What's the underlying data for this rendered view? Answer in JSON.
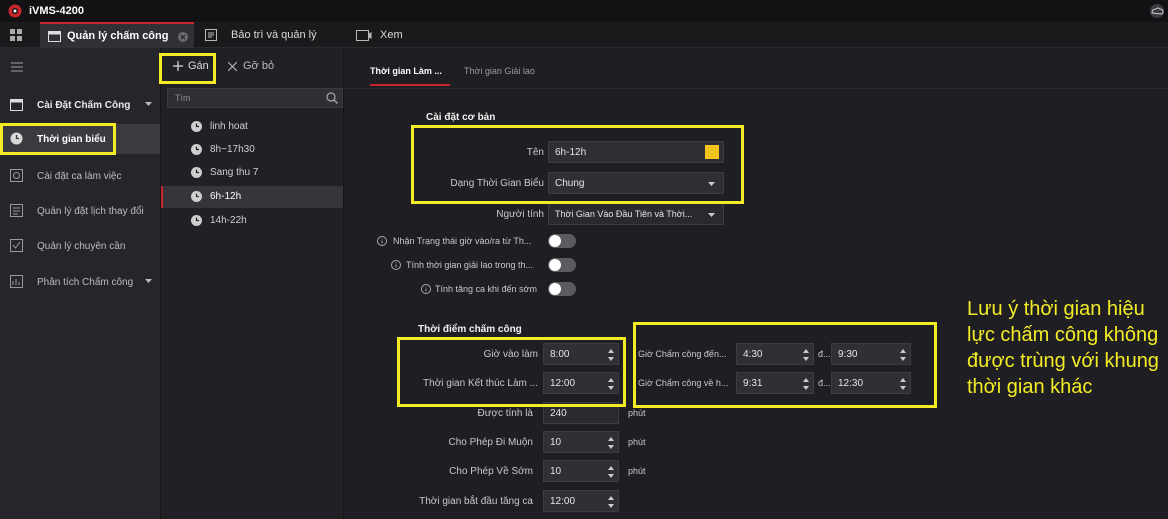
{
  "app": {
    "title": "iVMS-4200"
  },
  "topnav": {
    "tabs": [
      {
        "label": "Quản lý chấm công"
      },
      {
        "label": "Bảo trì và quản lý"
      },
      {
        "label": "Xem"
      }
    ]
  },
  "sidebar": {
    "items": [
      {
        "label": "Cài Đặt Chấm Công"
      },
      {
        "label": "Thời gian biểu"
      },
      {
        "label": "Cài đặt ca làm việc"
      },
      {
        "label": "Quản lý đặt lịch thay đổi"
      },
      {
        "label": "Quản lý chuyên cần"
      },
      {
        "label": "Phân tích Chấm công"
      }
    ]
  },
  "toolbar": {
    "add_label": "Gán",
    "remove_label": "Gỡ bỏ"
  },
  "search": {
    "placeholder": "Tìm"
  },
  "schedules": [
    "linh hoat",
    "8h~17h30",
    "Sang thu 7",
    "6h-12h",
    "14h-22h"
  ],
  "tabs": [
    {
      "label": "Thời gian Làm ..."
    },
    {
      "label": "Thời gian Giải lao"
    }
  ],
  "basic": {
    "heading": "Cài đặt cơ bản",
    "name_label": "Tên",
    "name_value": "6h-12h",
    "type_label": "Dạng Thời Gian Biểu",
    "type_value": "Chung",
    "calc_label": "Người tính",
    "calc_value": "Thời Gian Vào Đầu Tiên và Thời...",
    "toggle1_label": "Nhận Trạng thái giờ vào/ra từ Th...",
    "toggle2_label": "Tính thời gian giải lao trong th...",
    "toggle3_label": "Tính tăng ca khi đến sớm"
  },
  "checkin": {
    "heading": "Thời điểm chấm công",
    "start_label": "Giờ vào làm",
    "start_value": "8:00",
    "end_label": "Thời gian Kết thúc Làm ...",
    "end_value": "12:00",
    "counted_label": "Được tính là",
    "counted_value": "240",
    "counted_unit": "phút",
    "late_label": "Cho Phép Đi Muộn",
    "late_value": "10",
    "late_unit": "phút",
    "early_label": "Cho Phép Về Sớm",
    "early_value": "10",
    "early_unit": "phút",
    "ot_label": "Thời gian bắt đầu tăng ca",
    "ot_value": "12:00",
    "in_window_label": "Giờ Chấm công đến...",
    "in_from": "4:30",
    "in_to_label": "đ...",
    "in_to": "9:30",
    "out_window_label": "Giờ Chấm công về h...",
    "out_from": "9:31",
    "out_to_label": "đ...",
    "out_to": "12:30"
  },
  "note": "Lưu ý thời gian hiệu lực chấm công không được trùng với khung thời gian khác",
  "colors": {
    "highlight": "#f3ec25",
    "accent": "#c7262d",
    "color_swatch": "#f4c21b"
  }
}
